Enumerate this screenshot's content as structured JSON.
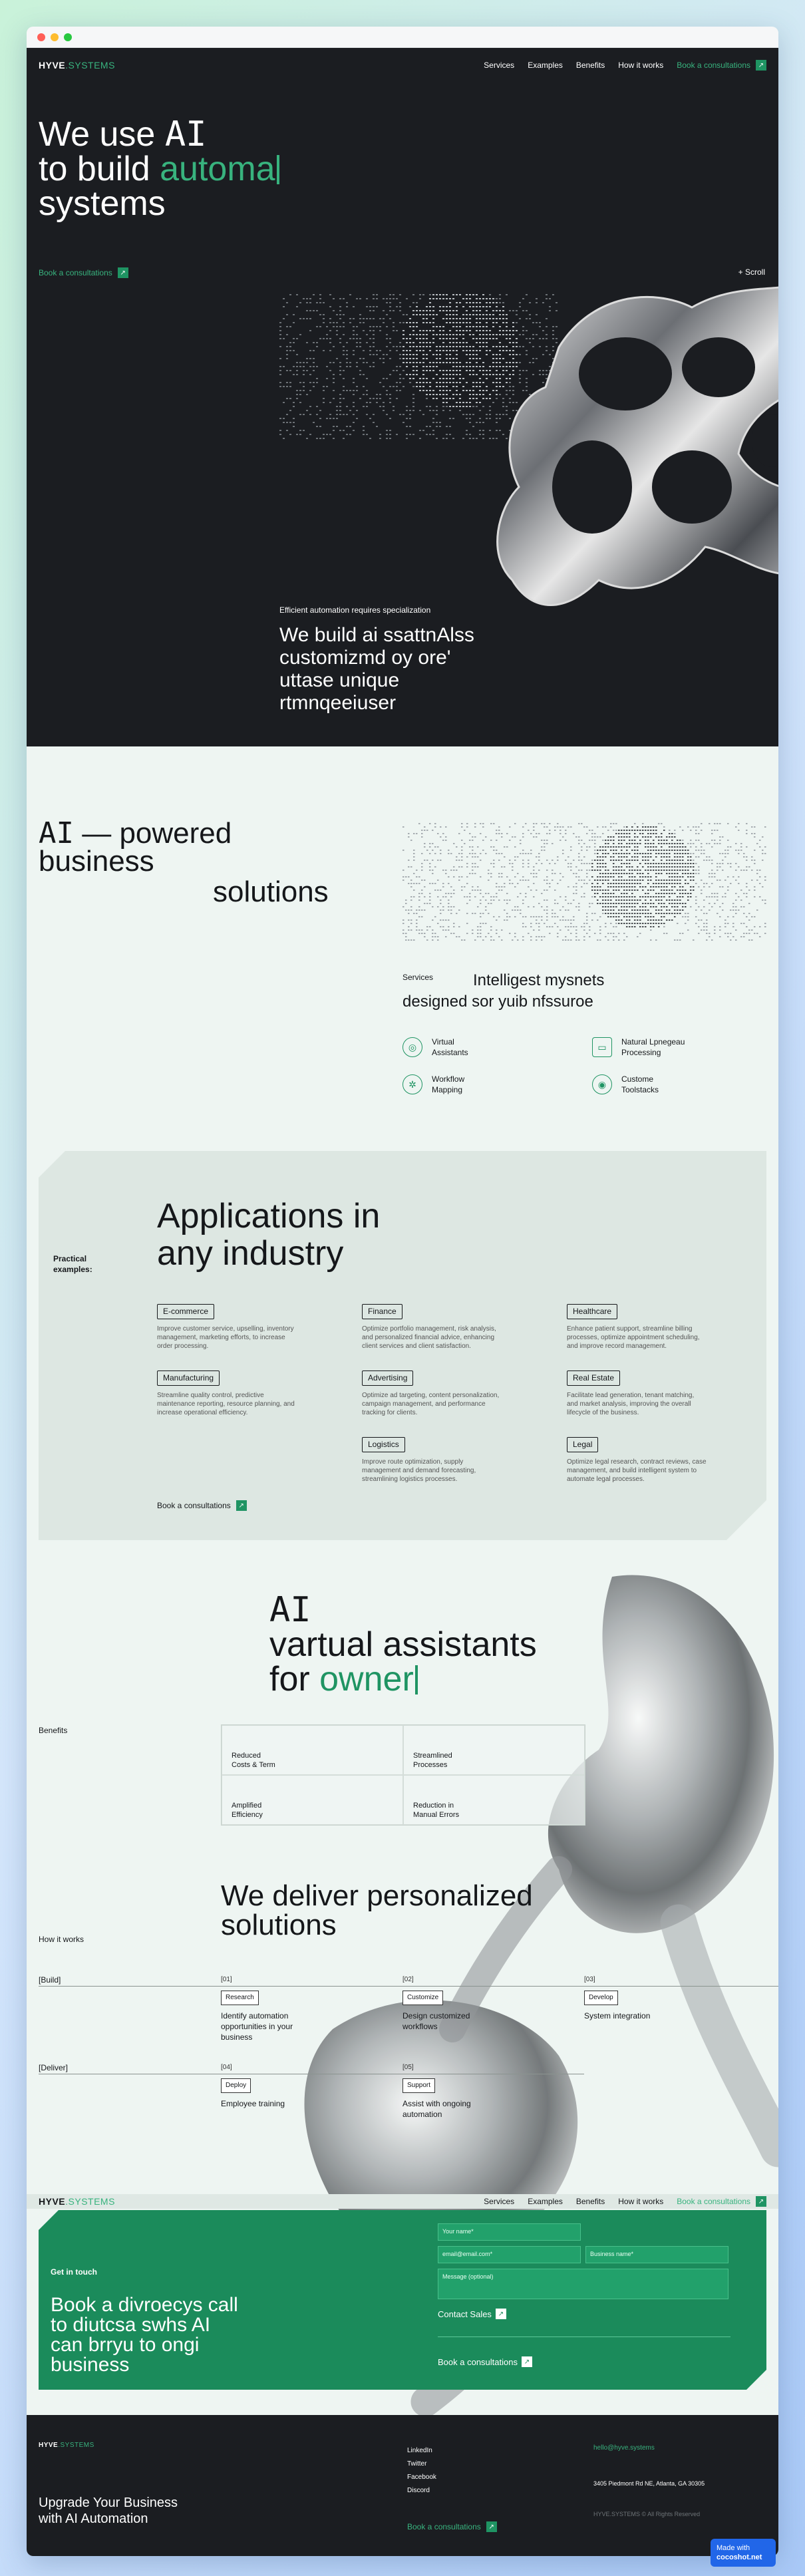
{
  "browser": {
    "dots": [
      "#ff5f57",
      "#febc2e",
      "#28c840"
    ]
  },
  "nav": {
    "logo_main": "HYVE",
    "logo_accent": ".SYSTEMS",
    "links": [
      "Services",
      "Examples",
      "Benefits",
      "How it works"
    ],
    "cta": "Book a consultations"
  },
  "hero": {
    "line1": "We use",
    "line1_mono": "AI",
    "line2_plain": "to build",
    "line2_accent": "automa",
    "line3": "systems",
    "cta": "Book a consultations",
    "scroll": "+ Scroll",
    "eyebrow": "Efficient automation requires specialization",
    "subtitle": "We build ai ssattnAlss customizmd oy ore' uttase unique rtmnqeeiuser"
  },
  "solutions": {
    "title_mono": "AI",
    "title_rest": "— powered",
    "title_line2": "business",
    "title_line3": "solutions",
    "services_label": "Services",
    "services_title": "Intelligest mysnets designed sor yuib nfssuroe",
    "items": [
      {
        "icon": "virtual-assistant-icon",
        "label": "Virtual Assistants"
      },
      {
        "icon": "language-processing-icon",
        "label": "Natural Lpnegeau Processing"
      },
      {
        "icon": "workflow-icon",
        "label": "Workflow Mapping"
      },
      {
        "icon": "toolstacks-icon",
        "label": "Custome Toolstacks"
      }
    ]
  },
  "apps": {
    "title": "Applications in any industry",
    "label": "Practical examples:",
    "cards": [
      {
        "tag": "E-commerce",
        "text": "Improve customer service, upselling, inventory management, marketing efforts, to increase order processing."
      },
      {
        "tag": "Finance",
        "text": "Optimize portfolio management, risk analysis, and personalized financial advice, enhancing client services and client satisfaction."
      },
      {
        "tag": "Healthcare",
        "text": "Enhance patient support, streamline billing processes, optimize appointment scheduling, and improve record management."
      },
      {
        "tag": "Manufacturing",
        "text": "Streamline quality control, predictive maintenance reporting, resource planning, and increase operational efficiency."
      },
      {
        "tag": "Advertising",
        "text": "Optimize ad targeting, content personalization, campaign management, and performance tracking for clients."
      },
      {
        "tag": "Real Estate",
        "text": "Facilitate lead generation, tenant matching, and market analysis, improving the overall lifecycle of the business."
      },
      {
        "tag": "Logistics",
        "text": "Improve route optimization, supply management and demand forecasting, streamlining logistics processes."
      },
      {
        "tag": "Legal",
        "text": "Optimize legal research, contract reviews, case management, and build intelligent system to automate legal processes."
      }
    ],
    "cta": "Book a consultations"
  },
  "assistants": {
    "title_mono": "AI",
    "title_line2": "vartual assistants",
    "title_line3_plain": "for",
    "title_line3_accent": "owner",
    "benefits_label": "Benefits",
    "benefits": [
      "Reduced Costs & Term",
      "Streamlined Processes",
      "Amplified Efficiency",
      "Reduction in Manual Errors"
    ]
  },
  "how": {
    "title": "We deliver personalized solutions",
    "label": "How it works",
    "steps": [
      {
        "phase": "[Build]",
        "num": "[01]",
        "badge": "Research",
        "text": "Identify automation opportunities in your business"
      },
      {
        "phase": "",
        "num": "[02]",
        "badge": "Customize",
        "text": "Design customized workflows"
      },
      {
        "phase": "",
        "num": "[03]",
        "badge": "Develop",
        "text": "System integration"
      },
      {
        "phase": "[Deliver]",
        "num": "[04]",
        "badge": "Deploy",
        "text": "Employee training"
      },
      {
        "phase": "",
        "num": "[05]",
        "badge": "Support",
        "text": "Assist with ongoing automation"
      }
    ]
  },
  "contact": {
    "label": "Get in touch",
    "title": "Book a divroecys call to diutcsa swhs AI can brryu to ongi business",
    "fields": {
      "name": "Your name*",
      "email": "email@email.com*",
      "business": "Business name*",
      "message": "Message (optional)"
    },
    "contact_sales": "Contact Sales",
    "cta": "Book a consultations"
  },
  "footer": {
    "logo_main": "HYVE",
    "logo_accent": ".SYSTEMS",
    "heading": "Upgrade Your Business with AI Automation",
    "links": [
      "LinkedIn",
      "Twitter",
      "Facebook",
      "Discord"
    ],
    "cta": "Book a consultations",
    "email": "hello@hyve.systems",
    "address": "3405 Piedmont Rd NE, Atlanta, GA 30305",
    "copyright": "HYVE.SYSTEMS © All Rights Reserved"
  },
  "badge": {
    "line1": "Made with",
    "line2": "cocoshot.net"
  }
}
